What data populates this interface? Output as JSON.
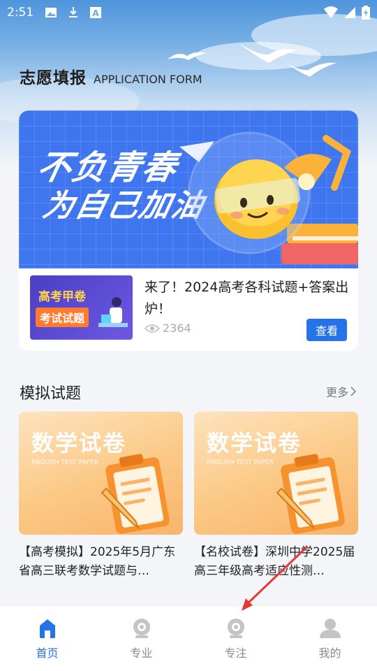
{
  "status_bar": {
    "time": "2:51"
  },
  "header": {
    "title_zh": "志愿填报",
    "title_en": "APPLICATION FORM"
  },
  "banner": {
    "slogan_line1": "不负青春",
    "slogan_line2": "为自己加油"
  },
  "featured_news": {
    "thumb_line1": "高考甲卷",
    "thumb_line2": "考试试题",
    "title": "来了！2024高考各科试题+答案出炉！",
    "views": "2364",
    "button_label": "查看"
  },
  "mock_exams": {
    "section_title": "模拟试题",
    "more_label": "更多",
    "items": [
      {
        "cover_title": "数学试卷",
        "cover_subtitle": "ENGLISH TEST PAPER",
        "title": "【高考模拟】2025年5月广东省高三联考数学试题与…"
      },
      {
        "cover_title": "数学试卷",
        "cover_subtitle": "ENGLISH TEST PAPER",
        "title": "【名校试卷】深圳中学2025届高三年级高考适应性测…"
      }
    ]
  },
  "tabbar": {
    "tabs": [
      {
        "label": "首页",
        "icon": "home-icon",
        "active": true
      },
      {
        "label": "专业",
        "icon": "webcam-icon",
        "active": false
      },
      {
        "label": "专注",
        "icon": "webcam-icon",
        "active": false
      },
      {
        "label": "我的",
        "icon": "person-icon",
        "active": false
      }
    ]
  },
  "colors": {
    "accent": "#2672e8",
    "banner_blue": "#3f76f0",
    "exam_cover": "#fbc884"
  }
}
